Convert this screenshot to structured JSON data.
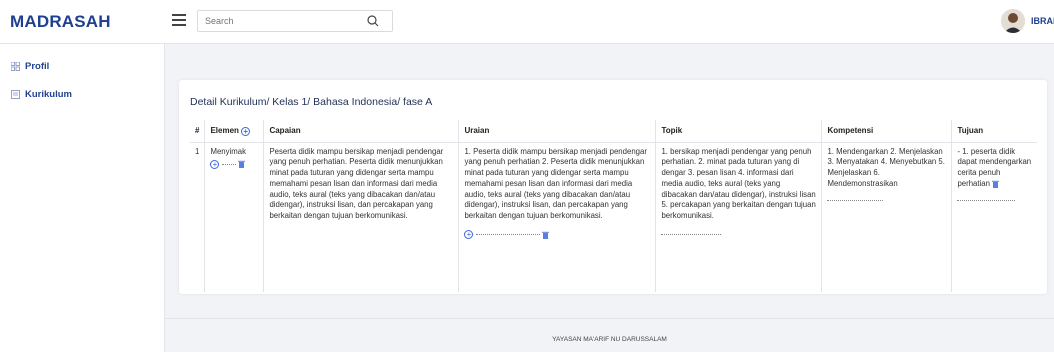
{
  "header": {
    "brand": "MADRASAH",
    "search_placeholder": "Search",
    "username": "IBRAHIM"
  },
  "sidebar": {
    "items": [
      {
        "label": "Profil",
        "icon": "grid-icon"
      },
      {
        "label": "Kurikulum",
        "icon": "document-icon"
      }
    ]
  },
  "main": {
    "title": "Detail Kurikulum/ Kelas 1/ Bahasa Indonesia/ fase A",
    "table": {
      "headers": [
        "#",
        "Elemen",
        "Capaian",
        "Uraian",
        "Topik",
        "Kompetensi",
        "Tujuan"
      ],
      "rows": [
        {
          "no": "1",
          "elemen": "Menyimak",
          "capaian": "Peserta didik mampu bersikap menjadi pendengar yang penuh perhatian. Peserta didik menunjukkan minat pada tuturan yang didengar serta mampu memahami pesan lisan dan informasi dari media audio, teks aural (teks yang dibacakan dan/atau didengar), instruksi lisan, dan percakapan yang berkaitan dengan tujuan berkomunikasi.",
          "uraian": "1. Peserta didik mampu bersikap menjadi pendengar yang penuh perhatian 2. Peserta didik menunjukkan minat pada tuturan yang didengar serta mampu memahami pesan lisan dan informasi dari media audio, teks aural (teks yang dibacakan dan/atau didengar), instruksi lisan, dan percakapan yang berkaitan dengan tujuan berkomunikasi.",
          "topik": "1. bersikap menjadi pendengar yang penuh perhatian. 2. minat pada tuturan yang di dengar 3. pesan lisan 4. informasi dari media audio, teks aural (teks yang dibacakan dan/atau didengar), instruksi lisan 5. percakapan yang berkaitan dengan tujuan berkomunikasi.",
          "kompetensi": "1. Mendengarkan 2. Menjelaskan 3. Menyatakan 4. Menyebutkan 5. Menjelaskan 6. Mendemonstrasikan",
          "tujuan": "- 1. peserta didik dapat mendengarkan cerita penuh perhatian"
        }
      ]
    }
  },
  "footer": {
    "text": "YAYASAN MA'ARIF NU DARUSSALAM"
  },
  "colors": {
    "brand": "#1f3f8f",
    "accent": "#3b66d8"
  }
}
